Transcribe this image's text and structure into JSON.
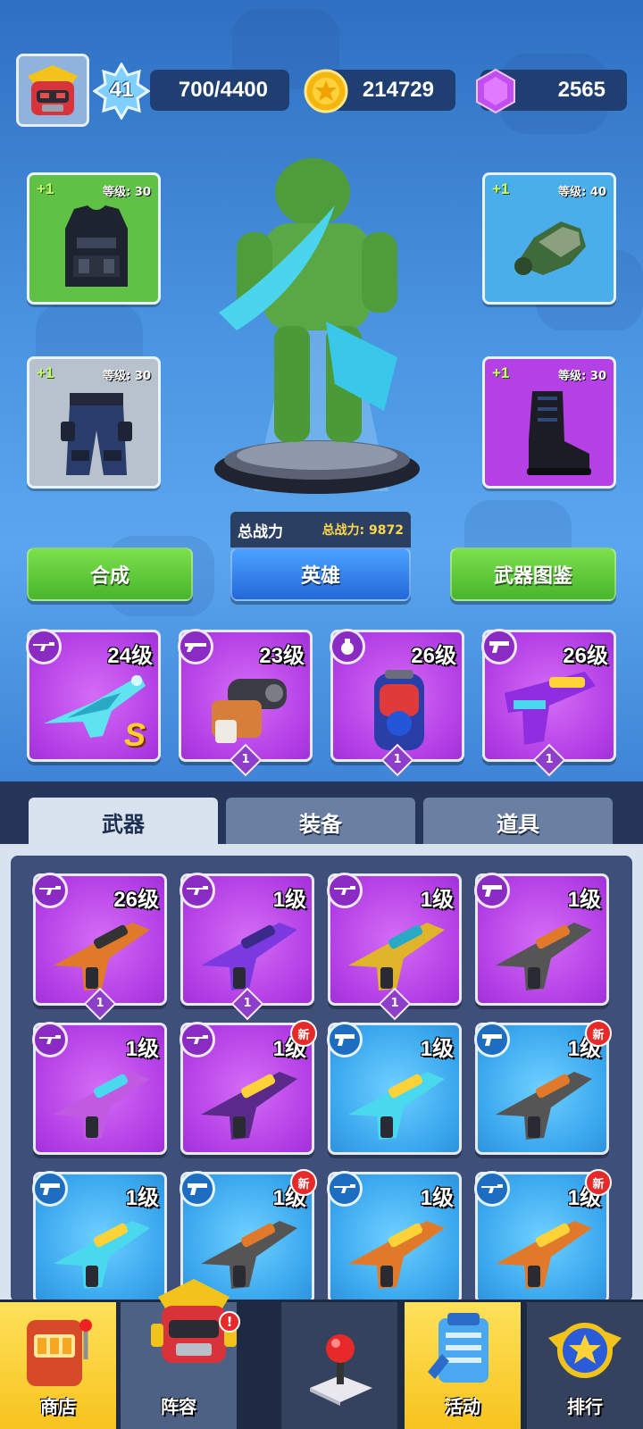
{
  "top_bar": {
    "level": "41",
    "xp_text": "700/4400",
    "coins": "214729",
    "gems": "2565"
  },
  "equipment": {
    "vest": {
      "plus": "+1",
      "level": "等级: 30"
    },
    "gloves": {
      "plus": "+1",
      "level": "等级: 40"
    },
    "pants": {
      "plus": "+1",
      "level": "等级: 30"
    },
    "boots": {
      "plus": "+1",
      "level": "等级: 30"
    }
  },
  "power": {
    "label": "总战力",
    "value_text": "总战力: 9872"
  },
  "buttons": {
    "combine": "合成",
    "hero": "英雄",
    "weapon_guide": "武器图鉴"
  },
  "equipped_weapons": [
    {
      "level": "24级",
      "badge": "S",
      "count": ""
    },
    {
      "level": "23级",
      "badge": "",
      "count": "1"
    },
    {
      "level": "26级",
      "badge": "",
      "count": "1"
    },
    {
      "level": "26级",
      "badge": "",
      "count": "1"
    }
  ],
  "tabs": [
    "武器",
    "装备",
    "道具"
  ],
  "inventory": [
    {
      "level": "26级",
      "count": "1",
      "new": ""
    },
    {
      "level": "1级",
      "count": "1",
      "new": ""
    },
    {
      "level": "1级",
      "count": "1",
      "new": ""
    },
    {
      "level": "1级",
      "count": "",
      "new": ""
    },
    {
      "level": "1级",
      "count": "",
      "new": ""
    },
    {
      "level": "1级",
      "count": "",
      "new": "新"
    },
    {
      "level": "1级",
      "count": "",
      "new": ""
    },
    {
      "level": "1级",
      "count": "",
      "new": "新"
    },
    {
      "level": "1级",
      "count": "",
      "new": ""
    },
    {
      "level": "1级",
      "count": "",
      "new": "新"
    },
    {
      "level": "1级",
      "count": "",
      "new": ""
    },
    {
      "level": "1级",
      "count": "",
      "new": "新"
    }
  ],
  "nav": {
    "shop": "商店",
    "lineup": "阵容",
    "play": "",
    "events": "活动",
    "ranking": "排行",
    "alert": "!"
  },
  "colors": {
    "accent_green": "#49b52d",
    "accent_blue": "#2368d8",
    "rarity_purple": "#b440e6",
    "rarity_blue": "#3aa7ee",
    "power_yellow": "#ffd84a"
  }
}
